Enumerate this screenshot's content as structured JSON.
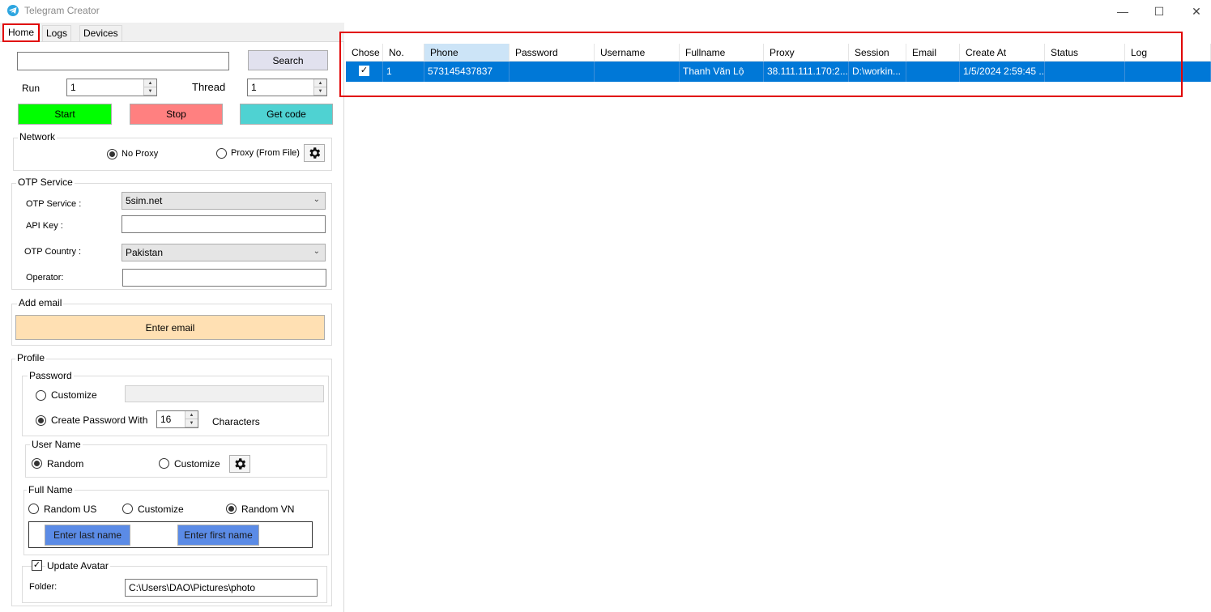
{
  "window": {
    "title": "Telegram Creator",
    "controls": {
      "minimize": "—",
      "maximize": "☐",
      "close": "✕"
    }
  },
  "tabs": [
    "Home",
    "Logs",
    "Devices"
  ],
  "top": {
    "search_value": "",
    "search_button": "Search",
    "run_label": "Run",
    "run_value": "1",
    "thread_label": "Thread",
    "thread_value": "1",
    "start": "Start",
    "stop": "Stop",
    "get_code": "Get code"
  },
  "network": {
    "title": "Network",
    "no_proxy": "No Proxy",
    "proxy_file": "Proxy (From File)"
  },
  "otp": {
    "title": "OTP Service",
    "service_label": "OTP Service :",
    "service_value": "5sim.net",
    "api_key_label": "API Key :",
    "api_key_value": "",
    "country_label": "OTP Country  :",
    "country_value": "Pakistan",
    "operator_label": "Operator:",
    "operator_value": ""
  },
  "email": {
    "title": "Add email",
    "button": "Enter email"
  },
  "profile": {
    "title": "Profile",
    "password": {
      "title": "Password",
      "customize": "Customize",
      "create_with": "Create Password With",
      "length": "16",
      "characters": "Characters"
    },
    "username": {
      "title": "User Name",
      "random": "Random",
      "customize": "Customize"
    },
    "fullname": {
      "title": "Full Name",
      "random_us": "Random US",
      "customize": "Customize",
      "random_vn": "Random VN",
      "last_name_btn": "Enter last name",
      "first_name_btn": "Enter first name"
    },
    "avatar": {
      "update": "Update Avatar",
      "folder_label": "Folder:",
      "folder_value": "C:\\Users\\DAO\\Pictures\\photo"
    }
  },
  "grid": {
    "columns": [
      "Chose",
      "No.",
      "Phone",
      "Password",
      "Username",
      "Fullname",
      "Proxy",
      "Session",
      "Email",
      "Create At",
      "Status",
      "Log"
    ],
    "rows": [
      {
        "no": "1",
        "phone": "573145437837",
        "password": "",
        "username": "",
        "fullname": "Thanh Văn Lộ",
        "proxy": "38.111.111.170:2...",
        "session": "D:\\workin...",
        "email": "",
        "create_at": "1/5/2024 2:59:45 ...",
        "status": "",
        "log": ""
      }
    ]
  },
  "colors": {
    "start": "#00ff00",
    "stop": "#ff8080",
    "get_code": "#4fd2d2",
    "email_btn": "#ffe0b3",
    "name_btn": "#5b8be6",
    "selection": "#0078d7",
    "highlight": "#e10000"
  }
}
